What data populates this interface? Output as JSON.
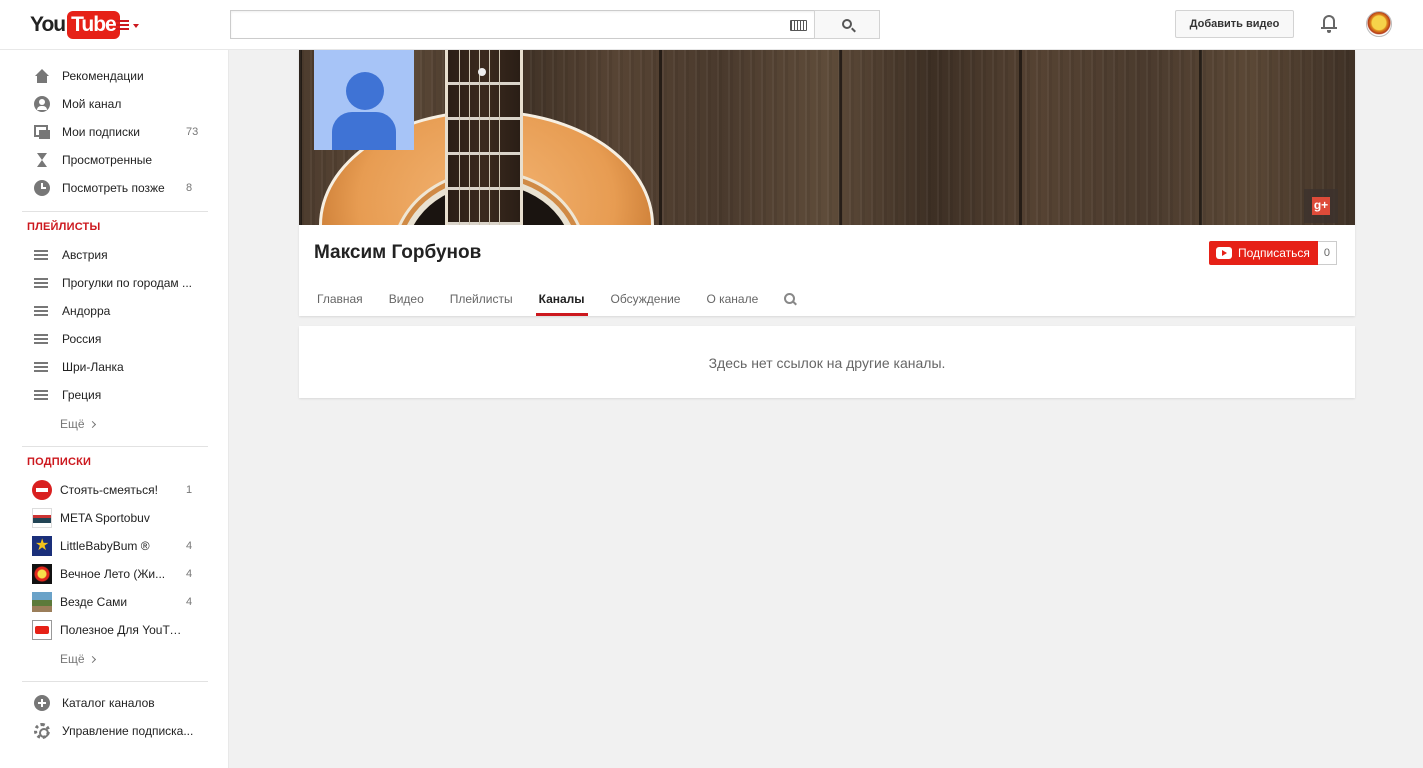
{
  "header": {
    "logo_you": "You",
    "logo_tube": "Tube",
    "search_placeholder": "",
    "search_value": "",
    "upload_label": "Добавить видео"
  },
  "sidebar": {
    "main": [
      {
        "label": "Рекомендации",
        "icon": "home-icon",
        "count": ""
      },
      {
        "label": "Мой канал",
        "icon": "user-icon",
        "count": ""
      },
      {
        "label": "Мои подписки",
        "icon": "subscriptions-icon",
        "count": "73"
      },
      {
        "label": "Просмотренные",
        "icon": "history-icon",
        "count": ""
      },
      {
        "label": "Посмотреть позже",
        "icon": "watch-later-icon",
        "count": "8"
      }
    ],
    "playlists_heading": "ПЛЕЙЛИСТЫ",
    "playlists": [
      {
        "label": "Австрия",
        "icon": "playlist-icon"
      },
      {
        "label": "Прогулки по городам ...",
        "icon": "playlist-icon"
      },
      {
        "label": "Андорра",
        "icon": "playlist-icon"
      },
      {
        "label": "Россия",
        "icon": "playlist-icon"
      },
      {
        "label": "Шри-Ланка",
        "icon": "playlist-icon"
      },
      {
        "label": "Греция",
        "icon": "playlist-icon"
      }
    ],
    "more_label": "Ещё",
    "subscriptions_heading": "ПОДПИСКИ",
    "subscriptions": [
      {
        "label": "Стоять-смеяться!",
        "count": "1"
      },
      {
        "label": "META Sportobuv",
        "count": ""
      },
      {
        "label": "LittleBabyBum ®",
        "count": "4"
      },
      {
        "label": "Вечное Лето (Жи...",
        "count": "4"
      },
      {
        "label": "Везде Сами",
        "count": "4"
      },
      {
        "label": "Полезное Для YouTube",
        "count": ""
      }
    ],
    "footer": [
      {
        "label": "Каталог каналов",
        "icon": "add-circle-icon"
      },
      {
        "label": "Управление подписка...",
        "icon": "gear-icon"
      }
    ]
  },
  "channel": {
    "title": "Максим Горбунов",
    "subscribe_label": "Подписаться",
    "subscriber_count": "0",
    "gplus_label": "g+",
    "tabs": [
      {
        "label": "Главная"
      },
      {
        "label": "Видео"
      },
      {
        "label": "Плейлисты"
      },
      {
        "label": "Каналы",
        "active": true
      },
      {
        "label": "Обсуждение"
      },
      {
        "label": "О канале"
      }
    ],
    "empty_message": "Здесь нет ссылок на другие каналы."
  },
  "colors": {
    "brand_red": "#e62117",
    "accent_red": "#cc181e",
    "avatar_bg": "#a7c4f7",
    "avatar_fg": "#3f73d5"
  }
}
